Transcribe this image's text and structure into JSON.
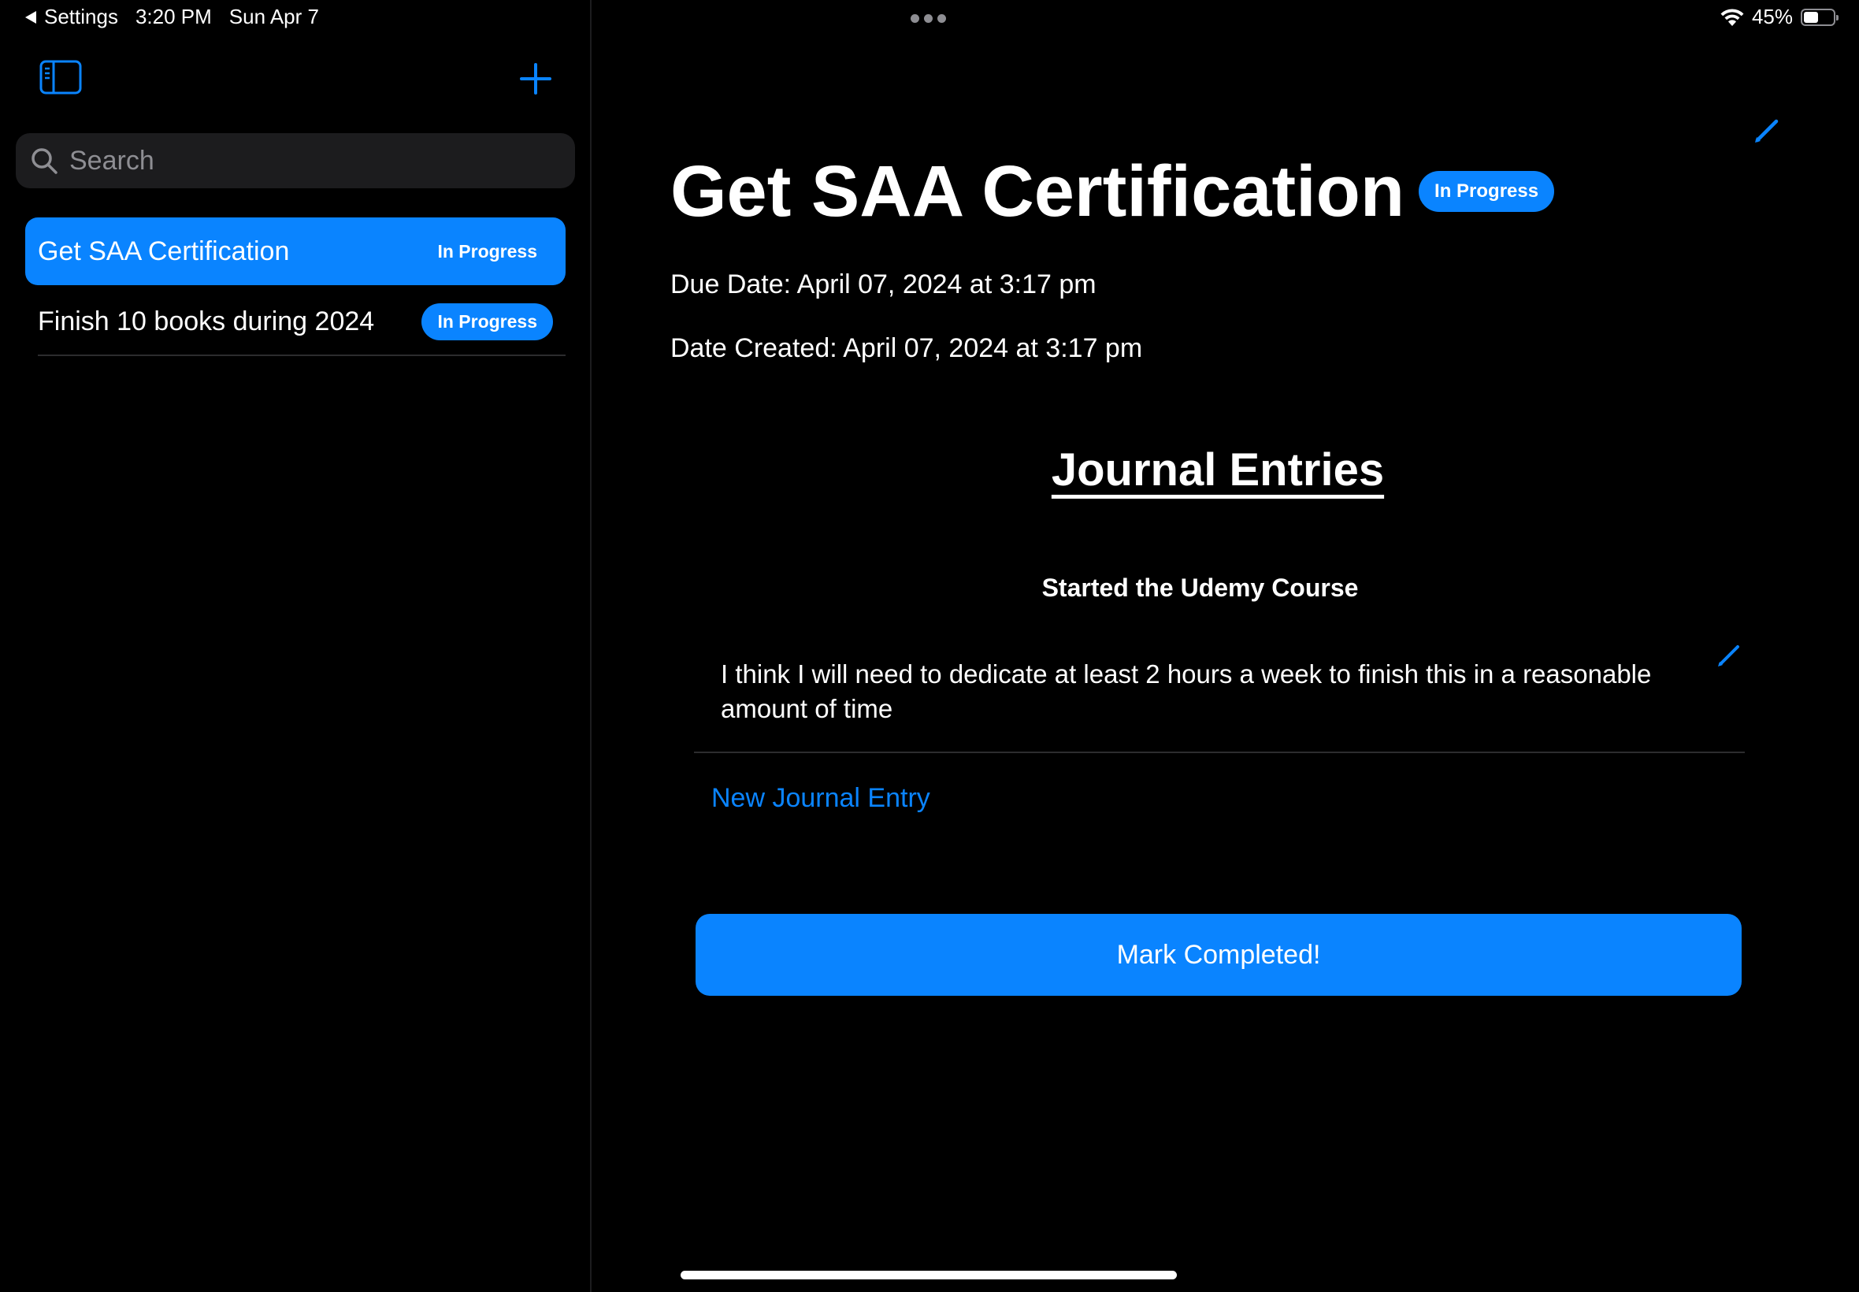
{
  "status_bar": {
    "back_label": "Settings",
    "time": "3:20 PM",
    "date": "Sun Apr 7",
    "battery": "45%"
  },
  "sidebar": {
    "search_placeholder": "Search",
    "goals": [
      {
        "title": "Get SAA Certification",
        "status": "In Progress",
        "selected": true
      },
      {
        "title": "Finish 10 books during 2024",
        "status": "In Progress",
        "selected": false
      }
    ]
  },
  "detail": {
    "title": "Get SAA Certification",
    "status": "In Progress",
    "due_date": "Due Date: April 07, 2024 at 3:17 pm",
    "date_created": "Date Created: April 07, 2024 at 3:17 pm",
    "journal_heading": "Journal Entries",
    "entries": [
      {
        "title": "Started the Udemy Course",
        "body": "I think I will need to dedicate at least 2 hours a week to finish this in a reasonable amount of time"
      }
    ],
    "new_entry_label": "New Journal Entry",
    "mark_completed_label": "Mark Completed!"
  },
  "colors": {
    "accent": "#0a84ff",
    "background": "#000000",
    "search_bg": "#1c1c1e"
  },
  "icons": [
    "back-arrow-icon",
    "wifi-icon",
    "battery-icon",
    "sidebar-toggle-icon",
    "add-icon",
    "search-icon",
    "pencil-icon"
  ]
}
